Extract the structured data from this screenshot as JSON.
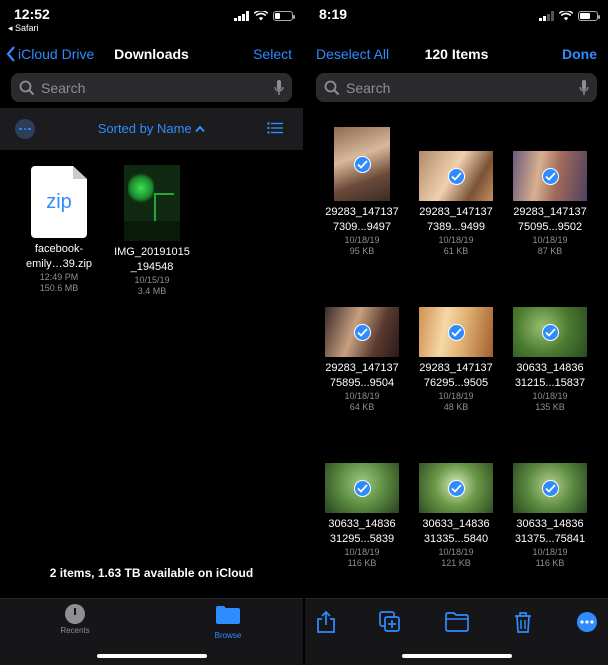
{
  "left": {
    "status": {
      "time": "12:52",
      "back_app": "◂ Safari"
    },
    "nav": {
      "back_label": "iCloud Drive",
      "title": "Downloads",
      "action": "Select"
    },
    "search": {
      "placeholder": "Search"
    },
    "sort": {
      "label": "Sorted by Name"
    },
    "files": [
      {
        "icon_text": "zip",
        "name_line1": "facebook-",
        "name_line2": "emily…39.zip",
        "time": "12:49 PM",
        "size": "150.6 MB"
      },
      {
        "name_line1": "IMG_20191015",
        "name_line2": "_194548",
        "time": "10/15/19",
        "size": "3.4 MB"
      }
    ],
    "storage_text": "2 items, 1.63 TB available on iCloud",
    "tabs": {
      "recents": "Recents",
      "browse": "Browse"
    }
  },
  "right": {
    "status": {
      "time": "8:19"
    },
    "nav": {
      "left_action": "Deselect All",
      "title": "120 Items",
      "right_action": "Done"
    },
    "search": {
      "placeholder": "Search"
    },
    "items": [
      {
        "l1": "29283_147137",
        "l2": "7309...9497",
        "date": "10/18/19",
        "size": "95 KB"
      },
      {
        "l1": "29283_147137",
        "l2": "7389...9499",
        "date": "10/18/19",
        "size": "61 KB"
      },
      {
        "l1": "29283_147137",
        "l2": "75095...9502",
        "date": "10/18/19",
        "size": "87 KB"
      },
      {
        "l1": "29283_147137",
        "l2": "75895...9504",
        "date": "10/18/19",
        "size": "64 KB"
      },
      {
        "l1": "29283_147137",
        "l2": "76295...9505",
        "date": "10/18/19",
        "size": "48 KB"
      },
      {
        "l1": "30633_14836",
        "l2": "31215...15837",
        "date": "10/18/19",
        "size": "135 KB"
      },
      {
        "l1": "30633_14836",
        "l2": "31295...5839",
        "date": "10/18/19",
        "size": "116 KB"
      },
      {
        "l1": "30633_14836",
        "l2": "31335...5840",
        "date": "10/18/19",
        "size": "121 KB"
      },
      {
        "l1": "30633_14836",
        "l2": "31375...75841",
        "date": "10/18/19",
        "size": "116 KB"
      }
    ]
  },
  "colors": {
    "accent": "#2f8cff",
    "secondary_text": "#8e8e93",
    "background": "#000000"
  }
}
